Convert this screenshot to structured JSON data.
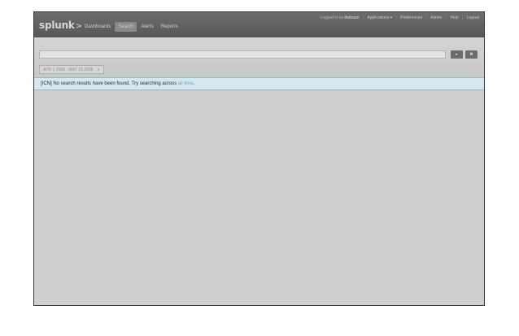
{
  "header": {
    "logo_text": "splunk",
    "logo_suffix": ">",
    "nav": [
      {
        "label": "Dashboards",
        "active": false
      },
      {
        "label": "Search",
        "active": true
      },
      {
        "label": "Alerts",
        "active": false
      },
      {
        "label": "Reports",
        "active": false
      }
    ],
    "userbar": {
      "logged_in_prefix": "Logged in as",
      "username": "thebauri",
      "applications": "Applications",
      "applications_caret": "▾",
      "preferences": "Preferences",
      "admin": "Admin",
      "help": "Help",
      "logout": "Logout",
      "separator": "|"
    }
  },
  "search": {
    "query_value": "",
    "run_button_glyph": "▸",
    "clear_button_glyph": "✖",
    "time_range": "APR 1 2008 - MAY 16 2008",
    "time_range_caret": "▼"
  },
  "message": {
    "icon_placeholder": "[ICN]",
    "text": "No search results have been found. Try searching across",
    "link_text": "all time",
    "suffix": "."
  },
  "colors": {
    "header_bg": "#5f5f5f",
    "search_bg": "#cfcfcf",
    "message_bg": "#d5e7ef",
    "link": "#7aa3b8"
  }
}
